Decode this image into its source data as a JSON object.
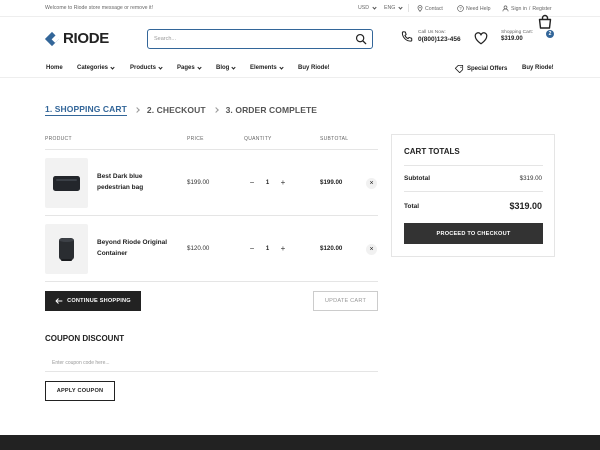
{
  "topbar": {
    "welcome": "Welcome to Riode store message or remove it!",
    "currency": "USD",
    "language": "ENG",
    "contact": "Contact",
    "help": "Need Help",
    "signin": "Sign in",
    "slash": "/",
    "register": "Register"
  },
  "header": {
    "logo": "RIODE",
    "search_placeholder": "Search...",
    "call_label": "Call Us Now:",
    "phone": "0(800)123-456",
    "cart_label": "Shopping Cart:",
    "cart_total": "$319.00",
    "cart_count": "2"
  },
  "nav": {
    "items": [
      "Home",
      "Categories",
      "Products",
      "Pages",
      "Blog",
      "Elements",
      "Buy Riode!"
    ],
    "special_offers": "Special Offers",
    "buy_right": "Buy Riode!"
  },
  "steps": [
    "1. SHOPPING CART",
    "2. CHECKOUT",
    "3. ORDER COMPLETE"
  ],
  "cart": {
    "headers": {
      "product": "PRODUCT",
      "price": "PRICE",
      "quantity": "QUANTITY",
      "subtotal": "SUBTOTAL"
    },
    "rows": [
      {
        "name": "Best Dark blue pedestrian bag",
        "price": "$199.00",
        "qty": "1",
        "subtotal": "$199.00"
      },
      {
        "name": "Beyond Riode Original Container",
        "price": "$120.00",
        "qty": "1",
        "subtotal": "$120.00"
      }
    ],
    "minus": "−",
    "plus": "+",
    "remove": "×",
    "continue": "CONTINUE SHOPPING",
    "update": "UPDATE CART"
  },
  "coupon": {
    "title": "COUPON DISCOUNT",
    "placeholder": "Enter coupon code here...",
    "apply": "APPLY COUPON"
  },
  "totals": {
    "title": "CART TOTALS",
    "subtotal_label": "Subtotal",
    "subtotal_value": "$319.00",
    "total_label": "Total",
    "total_value": "$319.00",
    "checkout": "PROCEED TO CHECKOUT"
  },
  "colors": {
    "accent": "#336699",
    "dark": "#222222"
  }
}
